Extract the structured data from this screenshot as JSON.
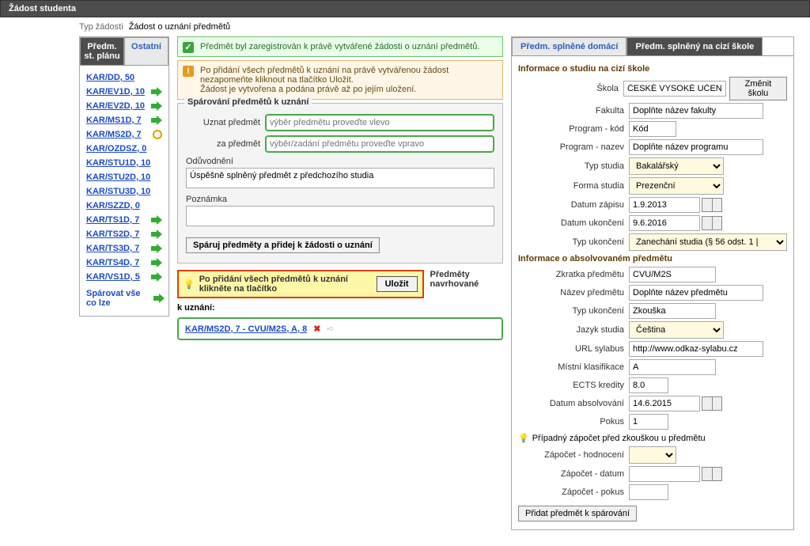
{
  "window_title": "Žádost studenta",
  "request_type_label": "Typ žádosti",
  "request_type_value": "Žádost o uznání předmětů",
  "left": {
    "tab_active": "Předm. st. plánu",
    "tab_other": "Ostatní",
    "items": [
      {
        "text": "KAR/DD, 50",
        "icon": ""
      },
      {
        "text": "KAR/EV1D, 10",
        "icon": "arrow"
      },
      {
        "text": "KAR/EV2D, 10",
        "icon": "arrow"
      },
      {
        "text": "KAR/MS1D, 7",
        "icon": "arrow"
      },
      {
        "text": "KAR/MS2D, 7",
        "icon": "pending"
      },
      {
        "text": "KAR/OZDSZ, 0",
        "icon": ""
      },
      {
        "text": "KAR/STU1D, 10",
        "icon": ""
      },
      {
        "text": "KAR/STU2D, 10",
        "icon": ""
      },
      {
        "text": "KAR/STU3D, 10",
        "icon": ""
      },
      {
        "text": "KAR/SZZD, 0",
        "icon": ""
      },
      {
        "text": "KAR/TS1D, 7",
        "icon": "arrow"
      },
      {
        "text": "KAR/TS2D, 7",
        "icon": "arrow"
      },
      {
        "text": "KAR/TS3D, 7",
        "icon": "arrow"
      },
      {
        "text": "KAR/TS4D, 7",
        "icon": "arrow"
      },
      {
        "text": "KAR/VS1D, 5",
        "icon": "arrow"
      }
    ],
    "pair_all": "Spárovat vše co lze"
  },
  "mid": {
    "msg_ok": "Předmět byl zaregistrován k právě vytvářené žádosti o uznání předmětů.",
    "msg_warn1": "Po přidání všech předmětů k uznání na právě vytvářenou žádost nezapomeňte kliknout na tlačítko Uložit.",
    "msg_warn2": "Žádost je vytvořena a podána právě až po jejím uložení.",
    "legend": "Spárování předmětů k uznání",
    "l_uznat": "Uznat předmět",
    "ph_uznat": "výběr předmětu proveďte vlevo",
    "l_za": "za předmět",
    "ph_za": "výběr/zadání předmětu proveďte vpravo",
    "l_oduv": "Odůvodnění",
    "v_oduv": "Úspěšně splněný předmět z předchozího studia",
    "l_pozn": "Poznámka",
    "btn_pair": "Spáruj předměty a přidej k žádosti o uznání",
    "save_hint": "Po přidání všech předmětů k uznání klikněte na tlačítko",
    "btn_save": "Uložit",
    "side_note": "Předměty navrhované",
    "to_list_header": "k uznání:",
    "pair_item": "KAR/MS2D, 7 - CVU/M2S, A, 8"
  },
  "right": {
    "tab1": "Předm. splněné domácí",
    "tab2": "Předm. splněný na cizí škole",
    "sec1": "Informace o studiu na cizí škole",
    "l_skola": "Škola",
    "v_skola": "ČESKÉ VYSOKÉ UČENÍ TE",
    "btn_zmenit": "Změnit školu",
    "l_fak": "Fakulta",
    "v_fak": "Doplňte název fakulty",
    "l_pkod": "Program - kód",
    "v_pkod": "Kód",
    "l_pnaz": "Program - nazev",
    "v_pnaz": "Doplňte název programu",
    "l_typ": "Typ studia",
    "v_typ": "Bakalářský",
    "l_forma": "Forma studia",
    "v_forma": "Prezenční",
    "l_dzap": "Datum zápisu",
    "v_dzap": "1.9.2013",
    "l_duk": "Datum ukončení",
    "v_duk": "9.6.2016",
    "l_tuk": "Typ ukončení",
    "v_tuk": "Zanechání studia (§ 56 odst. 1 |",
    "sec2": "Informace o absolvovaném předmětu",
    "l_zkr": "Zkratka předmětu",
    "v_zkr": "CVU/M2S",
    "l_naz": "Název předmětu",
    "v_naz": "Doplňte název předmětu",
    "l_tuk2": "Typ ukončení",
    "v_tuk2": "Zkouška",
    "l_jaz": "Jazyk studia",
    "v_jaz": "Čeština",
    "l_url": "URL sylabus",
    "v_url": "http://www.odkaz-sylabu.cz",
    "l_klas": "Místní klasifikace",
    "v_klas": "A",
    "l_ects": "ECTS kredity",
    "v_ects": "8.0",
    "l_dabs": "Datum absolvování",
    "v_dabs": "14.6.2015",
    "l_pokus": "Pokus",
    "v_pokus": "1",
    "hint": "Případný zápočet před zkouškou u předmětu",
    "l_zhod": "Zápočet - hodnocení",
    "l_zdat": "Zápočet - datum",
    "l_zpok": "Zápočet - pokus",
    "btn_add": "Přidat předmět k spárování"
  }
}
